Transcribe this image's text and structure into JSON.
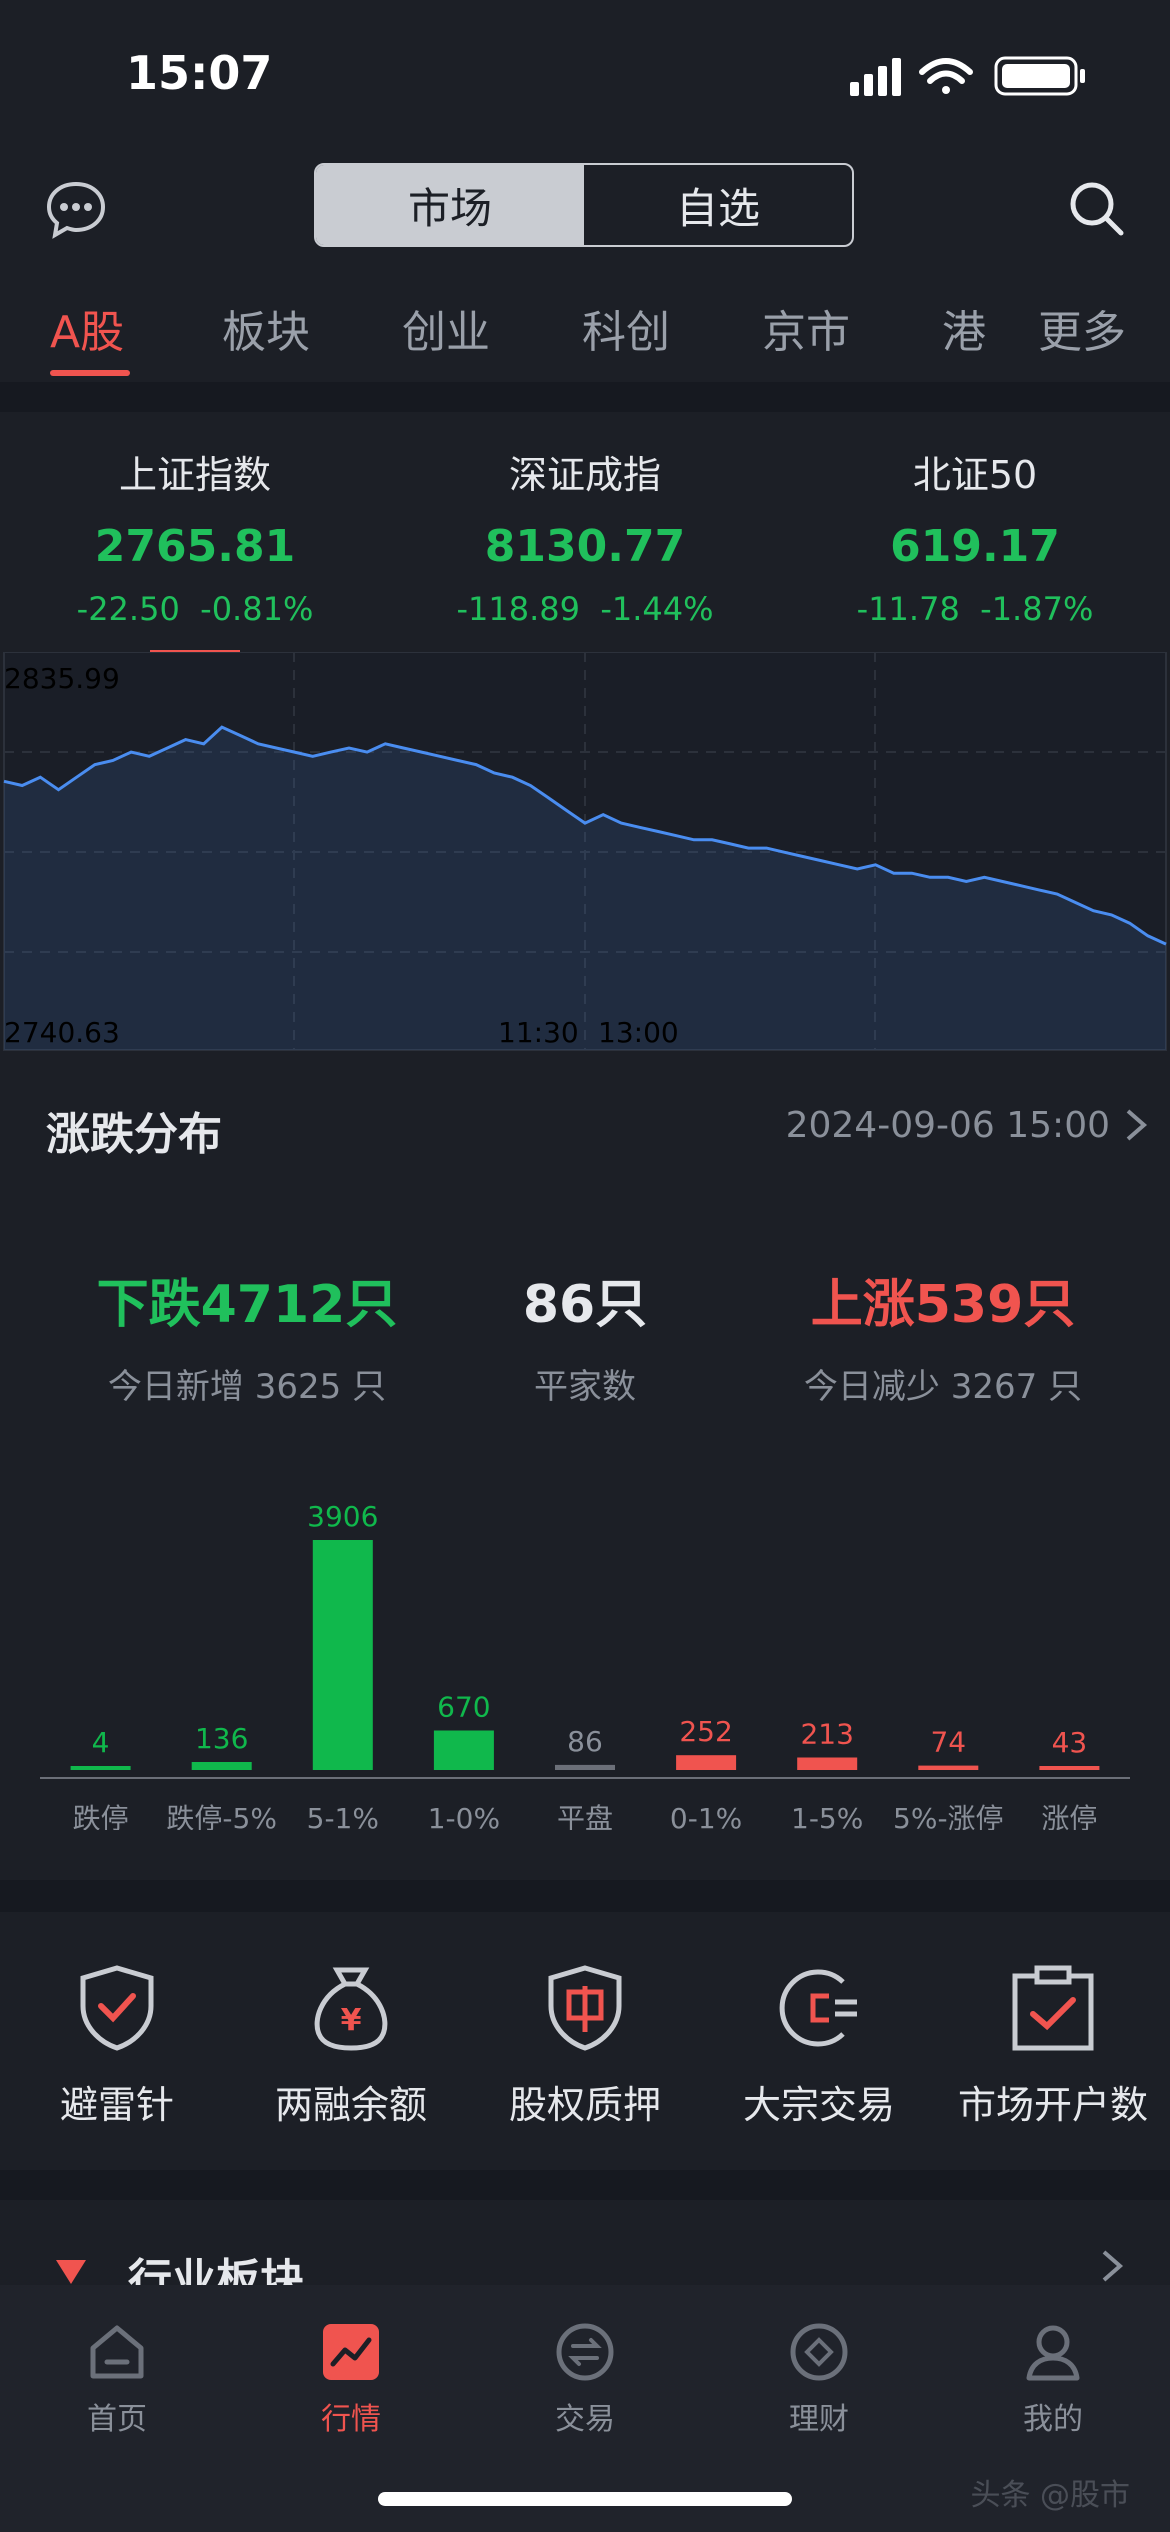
{
  "status": {
    "time": "15:07"
  },
  "header": {
    "segment": [
      "市场",
      "自选"
    ],
    "active_segment": 0
  },
  "tabs": [
    "A股",
    "板块",
    "创业",
    "科创",
    "京市",
    "港",
    "更多"
  ],
  "indices": [
    {
      "name": "上证指数",
      "value": "2765.81",
      "change": "-22.50",
      "pct": "-0.81%"
    },
    {
      "name": "深证成指",
      "value": "8130.77",
      "change": "-118.89",
      "pct": "-1.44%"
    },
    {
      "name": "北证50",
      "value": "619.17",
      "change": "-11.78",
      "pct": "-1.87%"
    }
  ],
  "chart_data": {
    "type": "line",
    "y_high_label": "2835.99",
    "y_low_label": "2740.63",
    "x_labels": [
      "11:30",
      "13:00"
    ],
    "ylim": [
      2740.63,
      2835.99
    ],
    "series": [
      {
        "values": [
          2805,
          2804,
          2806,
          2803,
          2806,
          2809,
          2810,
          2812,
          2811,
          2813,
          2815,
          2814,
          2818,
          2816,
          2814,
          2813,
          2812,
          2811,
          2812,
          2813,
          2812,
          2814,
          2813,
          2812,
          2811,
          2810,
          2809,
          2807,
          2806,
          2804,
          2801,
          2798,
          2795,
          2797,
          2795,
          2794,
          2793,
          2792,
          2791,
          2791,
          2790,
          2789,
          2789,
          2788,
          2787,
          2786,
          2785,
          2784,
          2785,
          2783,
          2783,
          2782,
          2782,
          2781,
          2782,
          2781,
          2780,
          2779,
          2778,
          2776,
          2774,
          2773,
          2771,
          2768,
          2766
        ]
      }
    ]
  },
  "distribution": {
    "title": "涨跌分布",
    "datetime": "2024-09-06 15:00",
    "down": {
      "label": "下跌4712只",
      "sub": "今日新增 3625 只"
    },
    "flat": {
      "label": "86只",
      "sub": "平家数"
    },
    "up": {
      "label": "上涨539只",
      "sub": "今日减少 3267 只"
    },
    "bars": {
      "type": "bar",
      "categories": [
        "跌停",
        "跌停-5%",
        "5-1%",
        "1-0%",
        "平盘",
        "0-1%",
        "1-5%",
        "5%-涨停",
        "涨停"
      ],
      "values": [
        4,
        136,
        3906,
        670,
        86,
        252,
        213,
        74,
        43
      ],
      "colors": [
        "#10b84c",
        "#10b84c",
        "#10b84c",
        "#10b84c",
        "#6b6f78",
        "#f0544f",
        "#f0544f",
        "#f0544f",
        "#f0544f"
      ]
    }
  },
  "tools": [
    {
      "label": "避雷针",
      "icon": "shield-check-icon"
    },
    {
      "label": "两融余额",
      "icon": "money-bag-icon"
    },
    {
      "label": "股权质押",
      "icon": "pledge-shield-icon"
    },
    {
      "label": "大宗交易",
      "icon": "bulk-trade-icon"
    },
    {
      "label": "市场开户数",
      "icon": "clipboard-check-icon"
    }
  ],
  "industry": {
    "title": "行业板块"
  },
  "nav": [
    {
      "label": "首页",
      "icon": "home-icon"
    },
    {
      "label": "行情",
      "icon": "chart-icon"
    },
    {
      "label": "交易",
      "icon": "exchange-icon"
    },
    {
      "label": "理财",
      "icon": "diamond-icon"
    },
    {
      "label": "我的",
      "icon": "user-icon"
    }
  ],
  "watermark": "头条 @股市"
}
